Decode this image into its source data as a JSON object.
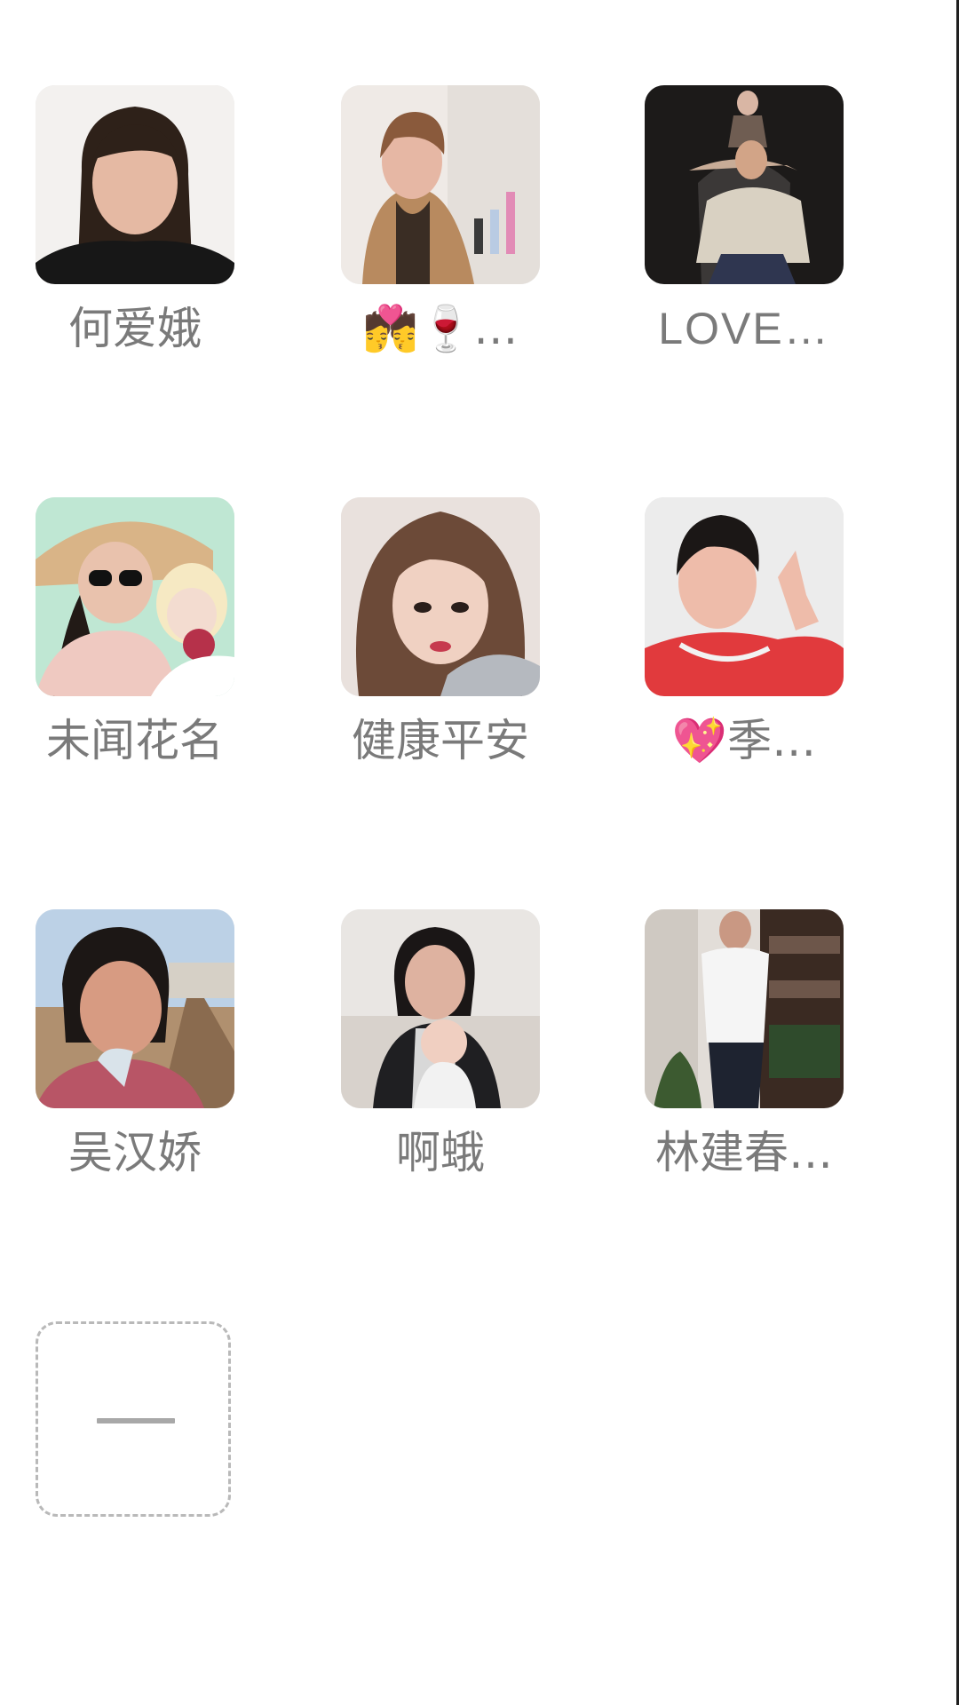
{
  "members": [
    {
      "name": "何爱娥",
      "avatar_icon": "member-photo"
    },
    {
      "name": "💏🍷…",
      "avatar_icon": "member-photo"
    },
    {
      "name": "LOVE…",
      "avatar_icon": "member-photo"
    },
    {
      "name": "未闻花名",
      "avatar_icon": "member-photo"
    },
    {
      "name": "健康平安",
      "avatar_icon": "member-photo"
    },
    {
      "name": "💖季…",
      "avatar_icon": "member-photo"
    },
    {
      "name": "吴汉娇",
      "avatar_icon": "member-photo"
    },
    {
      "name": "啊蛾",
      "avatar_icon": "member-photo"
    },
    {
      "name": "林建春…",
      "avatar_icon": "member-photo"
    }
  ],
  "actions": {
    "remove_icon": "minus-icon"
  },
  "colors": {
    "background": "#ffffff",
    "name_text": "#7a7a7a",
    "dashed_border": "#b9b9b9"
  }
}
